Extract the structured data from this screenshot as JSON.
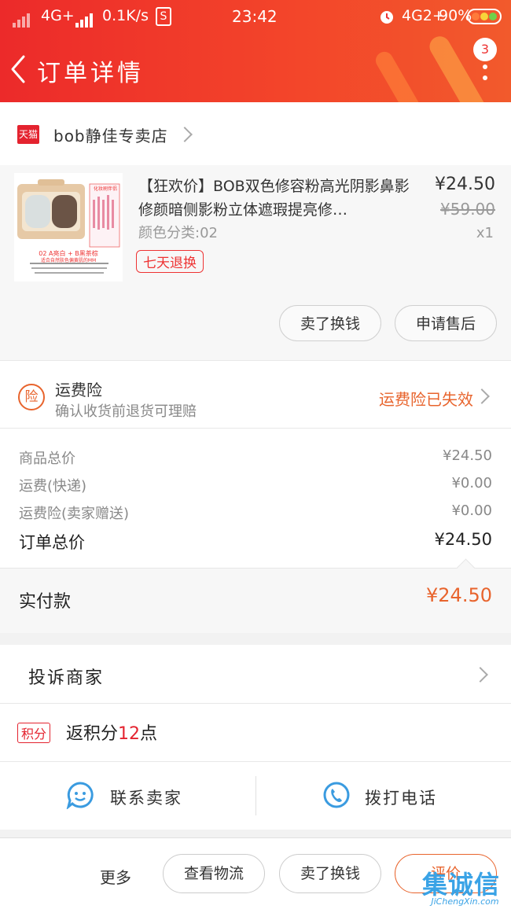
{
  "status_bar": {
    "network": "4G+",
    "speed": "0.1K/s",
    "s_icon": "S",
    "time": "23:42",
    "network2": "4G2+",
    "battery_percent": "90%"
  },
  "header": {
    "title": "订单详情",
    "badge_count": "3"
  },
  "store": {
    "platform_badge": "天猫",
    "name": "bob静佳专卖店"
  },
  "product": {
    "name": "【狂欢价】BOB双色修容粉高光阴影鼻影修颜暗侧影粉立体遮瑕提亮修…",
    "price": "¥24.50",
    "original_price": "¥59.00",
    "quantity": "x1",
    "variant": "颜色分类:02",
    "return_tag": "七天退换",
    "thumbnail_tag": "化妆刷伴侣",
    "thumbnail_caption": "02 A亮白 + B黑茶棕",
    "thumbnail_subcaption": "适合自然肤色偏黄肌的MM",
    "buttons": {
      "sell_again": "卖了换钱",
      "after_sales": "申请售后"
    }
  },
  "insurance": {
    "icon_text": "险",
    "title": "运费险",
    "description": "确认收货前退货可理赔",
    "status": "运费险已失效"
  },
  "summary": {
    "rows": [
      {
        "label": "商品总价",
        "value": "¥24.50"
      },
      {
        "label": "运费(快递)",
        "value": "¥0.00"
      },
      {
        "label": "运费险(卖家赠送)",
        "value": "¥0.00"
      }
    ],
    "total_label": "订单总价",
    "total_value": "¥24.50",
    "paid_label": "实付款",
    "paid_value": "¥24.50"
  },
  "complaint": {
    "label": "投诉商家"
  },
  "points": {
    "badge": "积分",
    "prefix": "返积分",
    "count": "12",
    "suffix": "点"
  },
  "contact": {
    "seller": "联系卖家",
    "call": "拨打电话"
  },
  "bottom_bar": {
    "more": "更多",
    "logistics": "查看物流",
    "sell": "卖了换钱",
    "review": "评价"
  },
  "watermark": {
    "main": "集诚信",
    "url": "JiChengXin.com"
  },
  "colors": {
    "header_red": "#ec2a2a",
    "accent_orange": "#e8642d",
    "tmall_red": "#e4232f",
    "contact_blue": "#3a9be0"
  }
}
